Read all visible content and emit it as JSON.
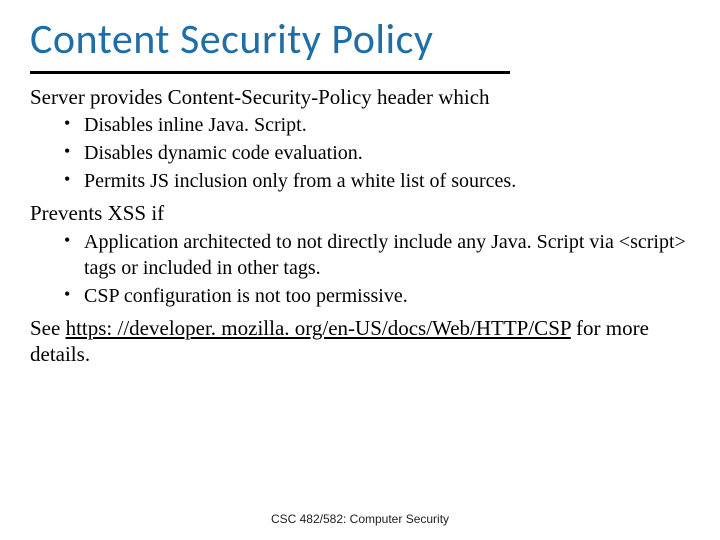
{
  "title": "Content Security Policy",
  "section1": {
    "lead": "Server provides Content-Security-Policy header which",
    "items": [
      "Disables inline Java. Script.",
      "Disables dynamic code evaluation.",
      "Permits JS inclusion only from a white list of sources."
    ]
  },
  "section2": {
    "lead": "Prevents XSS if",
    "items": [
      "Application architected to not directly include any Java. Script via <script> tags or included in other tags.",
      "CSP configuration is not too permissive."
    ]
  },
  "see_prefix": "See ",
  "see_link": "https: //developer. mozilla. org/en-US/docs/Web/HTTP/CSP",
  "see_suffix": " for more details.",
  "footer": "CSC 482/582: Computer Security"
}
